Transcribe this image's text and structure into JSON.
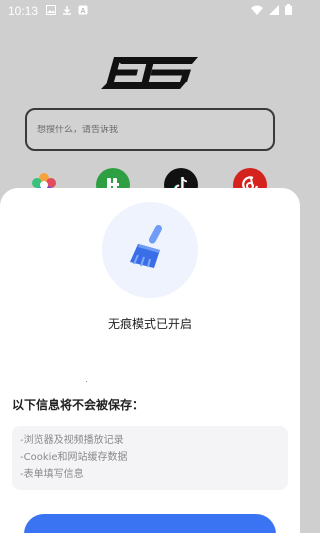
{
  "status_bar": {
    "time": "10:13",
    "left_icons": [
      "image-icon",
      "download-icon",
      "notification-icon"
    ],
    "right_icons": [
      "wifi-icon",
      "signal-icon",
      "battery-icon"
    ]
  },
  "logo": {
    "name": "ES logo"
  },
  "search": {
    "placeholder": "想搜什么，请告诉我"
  },
  "shortcuts": [
    {
      "icon": "colorful-flower-icon"
    },
    {
      "icon": "green-app-icon"
    },
    {
      "icon": "tiktok-icon"
    },
    {
      "icon": "netease-music-icon"
    }
  ],
  "sheet": {
    "icon": "broom-icon",
    "title": "无痕模式已开启",
    "heading": "以下信息将不会被保存：",
    "items": [
      "-浏览器及视频播放记录",
      "-Cookie和网站缓存数据",
      "-表单填写信息"
    ]
  },
  "colors": {
    "accent": "#3b74f2",
    "broom_light": "#6f9cf6",
    "broom_dark": "#3a6ee8",
    "backdrop": "#cfcfcf"
  }
}
